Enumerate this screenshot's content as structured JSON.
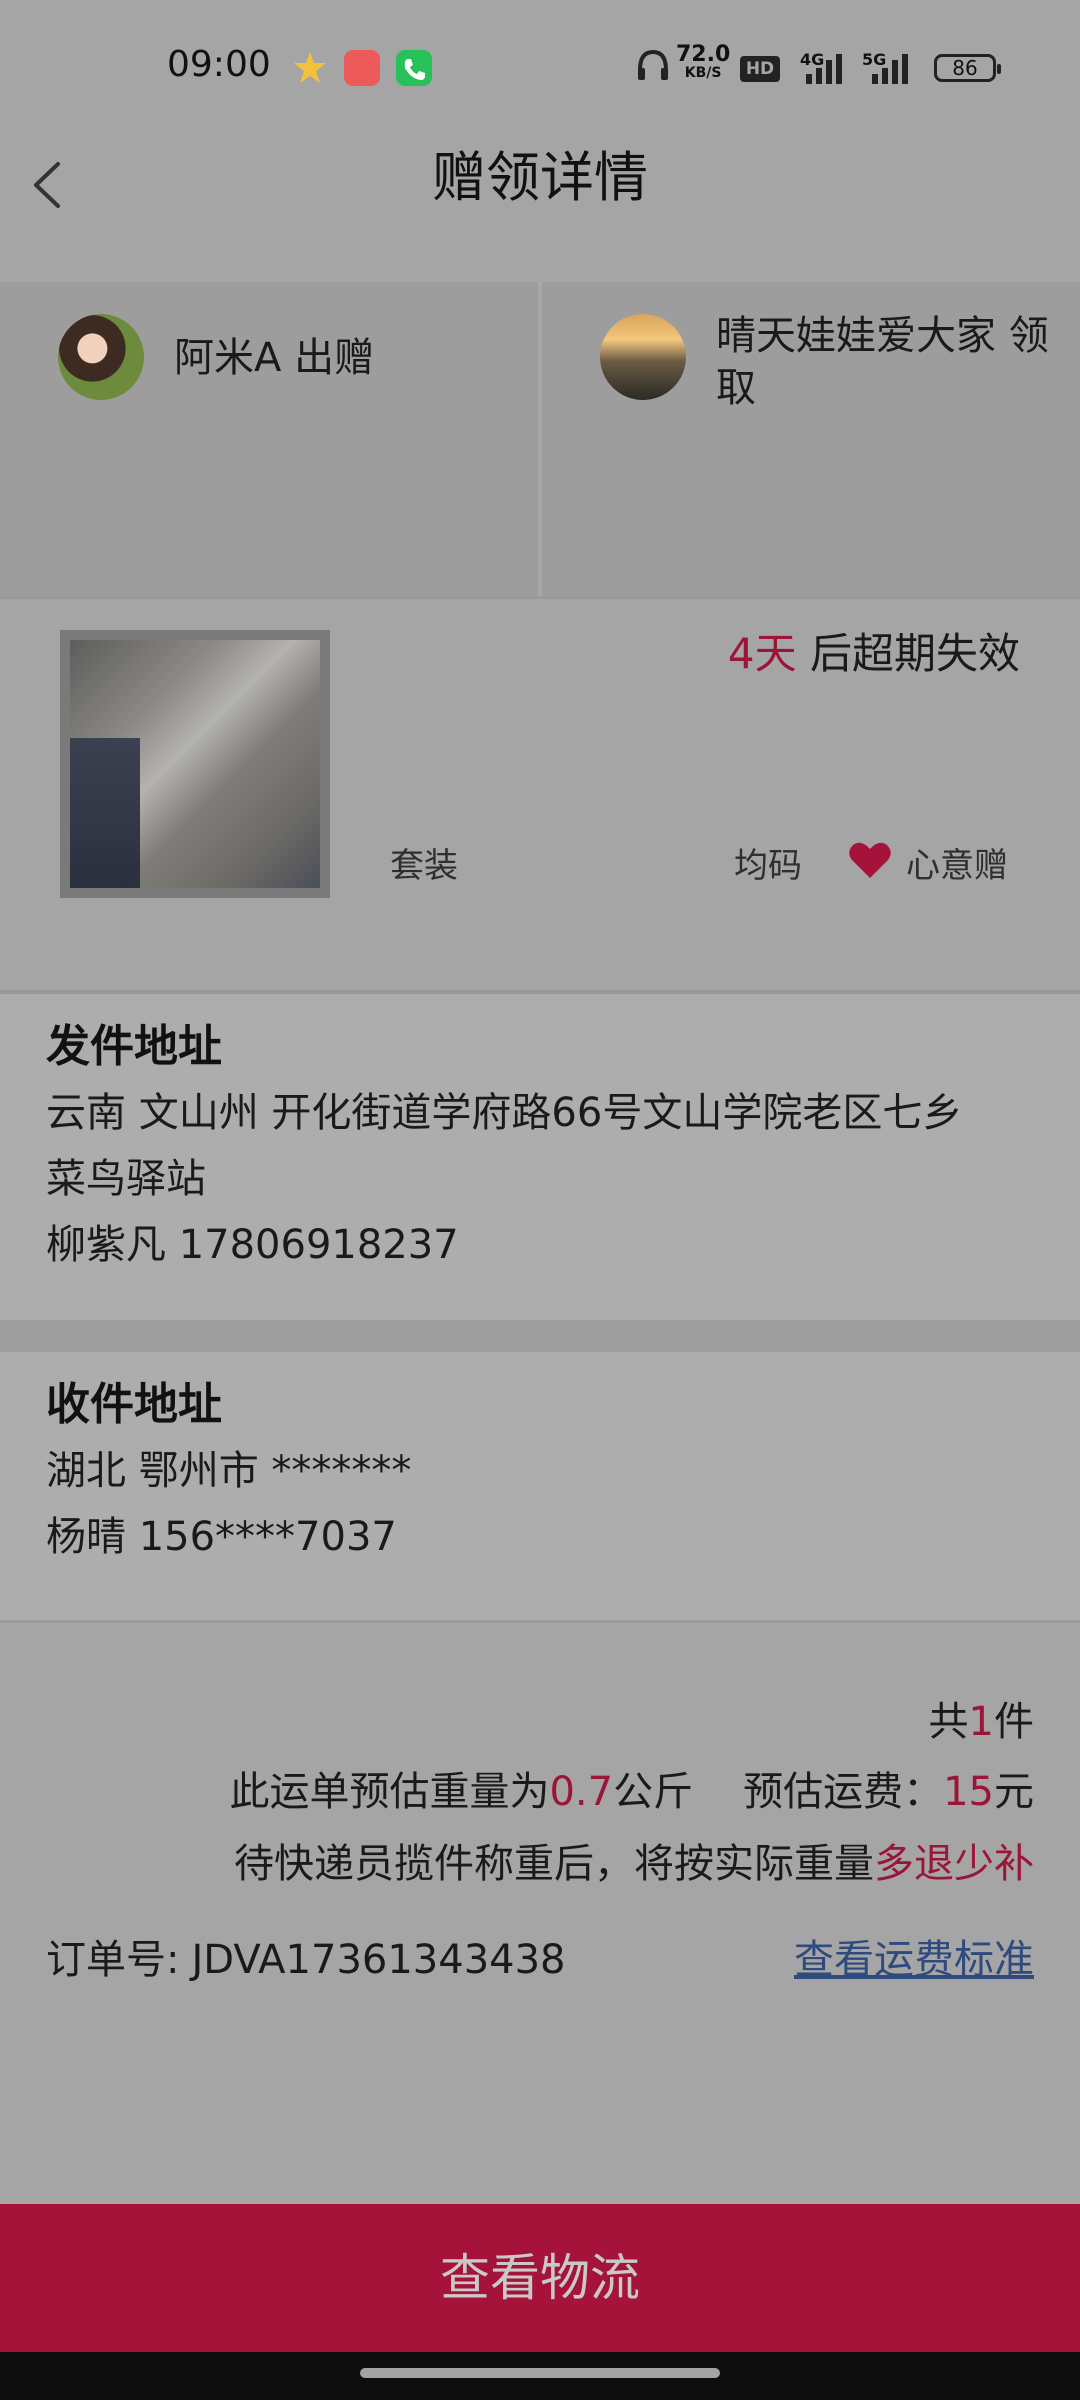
{
  "status_bar": {
    "time": "09:00",
    "net_speed_value": "72.0",
    "net_speed_unit": "KB/S",
    "hd_badge": "HD",
    "network_1": "4G",
    "network_2": "5G",
    "battery": "86"
  },
  "header": {
    "title": "赠领详情"
  },
  "participants": {
    "giver_text": "阿米A 出赠",
    "receiver_text": "晴天娃娃爱大家 领取"
  },
  "item": {
    "expiry_days": "4天",
    "expiry_suffix": " 后超期失效",
    "type": "套装",
    "size": "均码",
    "gift_label": "心意赠"
  },
  "send_address": {
    "title": "发件地址",
    "address_line1": "云南 文山州 开化街道学府路66号文山学院老区七乡",
    "address_line2": "菜鸟驿站",
    "contact": "柳紫凡 17806918237"
  },
  "receive_address": {
    "title": "收件地址",
    "address": "湖北 鄂州市 *******",
    "contact": "杨晴 156****7037"
  },
  "shipping": {
    "count_prefix": "共",
    "count": "1",
    "count_suffix": "件",
    "weight_prefix": "此运单预估重量为",
    "weight": "0.7",
    "weight_unit": "公斤",
    "fee_prefix": "预估运费：",
    "fee": "15",
    "fee_unit": "元",
    "note_prefix": "待快递员揽件称重后，将按实际重量",
    "note_highlight": "多退少补"
  },
  "order": {
    "label": "订单号:",
    "number": "JDVA17361343438",
    "fee_standard_link": "查看运费标准"
  },
  "actions": {
    "view_logistics": "查看物流"
  },
  "colors": {
    "accent": "#a6133a",
    "highlight_red": "#9a1538",
    "link_blue": "#2f4a7e"
  }
}
